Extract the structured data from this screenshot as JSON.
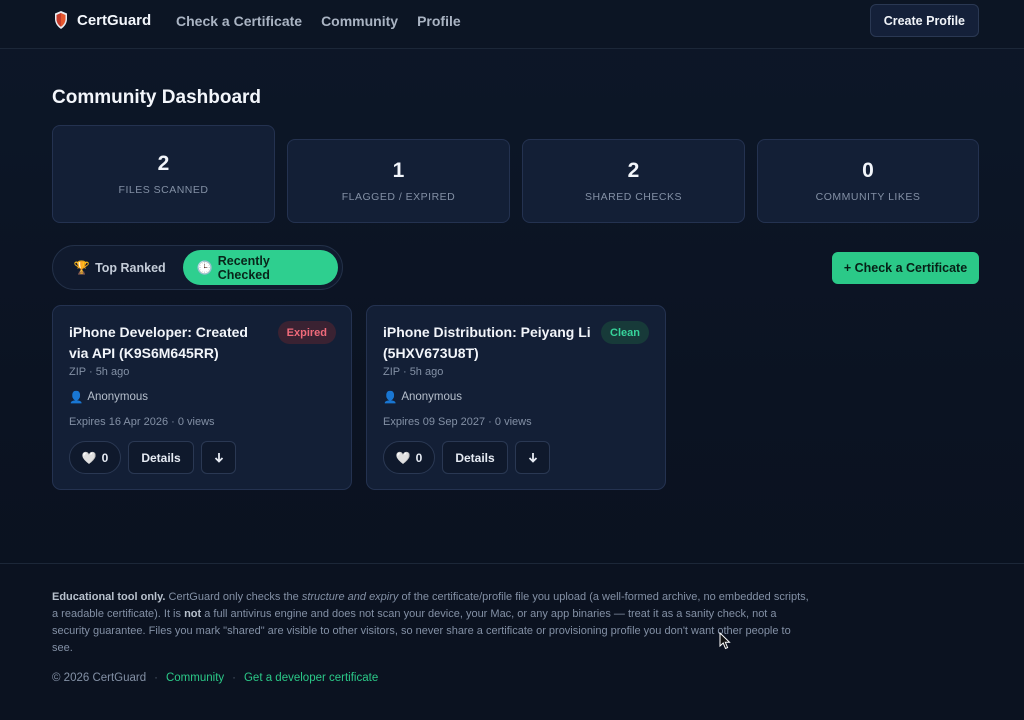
{
  "nav": {
    "brand": "CertGuard",
    "links": [
      "Check a Certificate",
      "Community",
      "Profile"
    ],
    "create_profile": "Create Profile"
  },
  "page_title": "Community Dashboard",
  "stats": [
    {
      "value": "2",
      "label": "FILES SCANNED"
    },
    {
      "value": "1",
      "label": "FLAGGED / EXPIRED"
    },
    {
      "value": "2",
      "label": "SHARED CHECKS"
    },
    {
      "value": "0",
      "label": "COMMUNITY LIKES"
    }
  ],
  "tabs": {
    "top_ranked": "Top Ranked",
    "recently_checked": "Recently Checked",
    "active": "recently_checked"
  },
  "check_button": "+ Check a Certificate",
  "cards": [
    {
      "title": "iPhone Developer: Created via API (K9S6M645RR)",
      "badge": "Expired",
      "meta": "ZIP · 5h ago",
      "owner": "Anonymous",
      "expiry": "Expires 16 Apr 2026 · 0 views",
      "likes": "0",
      "details": "Details"
    },
    {
      "title": "iPhone Distribution: Peiyang Li (5HXV673U8T)",
      "badge": "Clean",
      "meta": "ZIP · 5h ago",
      "owner": "Anonymous",
      "expiry": "Expires 09 Sep 2027 · 0 views",
      "likes": "0",
      "details": "Details"
    }
  ],
  "footer": {
    "note_bold": "Educational tool only.",
    "note_part1": " CertGuard only checks the ",
    "note_em": "structure and expiry",
    "note_part2": " of the certificate/profile file you upload (a well-formed archive, no embedded scripts, a readable certificate). It is ",
    "note_not": "not",
    "note_part3": " a full antivirus engine and does not scan your device, your Mac, or any app binaries — treat it as a sanity check, not a security guarantee. Files you mark \"shared\" are visible to other visitors, so never share a certificate or provisioning profile you don't want other people to see.",
    "copyright": "© 2026 CertGuard",
    "link_community": "Community",
    "link_dev_cert": "Get a developer certificate"
  },
  "colors": {
    "accent": "#2bc988",
    "expired": "#f06a7a",
    "background": "#0b1322"
  }
}
